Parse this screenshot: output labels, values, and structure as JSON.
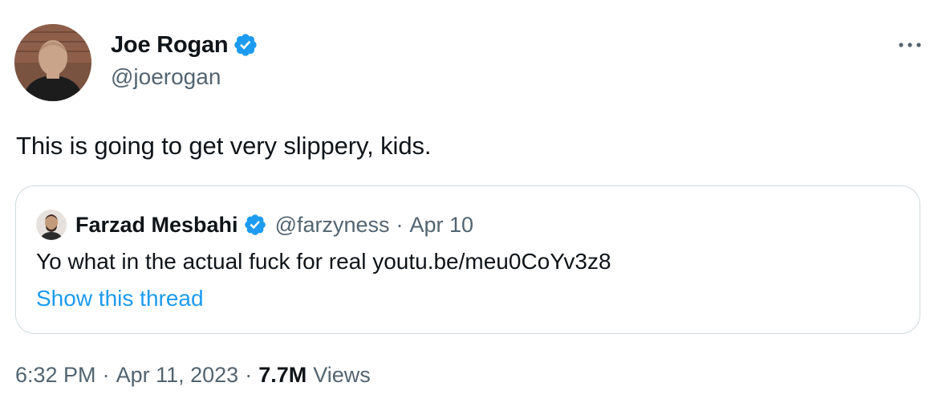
{
  "tweet": {
    "author": {
      "display_name": "Joe Rogan",
      "handle": "@joerogan",
      "verified": true
    },
    "text": "This is going to get very slippery, kids.",
    "quote": {
      "author_name": "Farzad Mesbahi",
      "author_handle": "@farzyness",
      "separator": "·",
      "date": "Apr 10",
      "verified": true,
      "text": "Yo what in the actual fuck for real youtu.be/meu0CoYv3z8",
      "show_thread_label": "Show this thread"
    },
    "meta": {
      "time": "6:32 PM",
      "separator": "·",
      "date": "Apr 11, 2023",
      "views_count": "7.7M",
      "views_label": "Views"
    }
  },
  "icons": {
    "verified": "verified-badge-icon",
    "more": "more-options-icon"
  },
  "colors": {
    "verified_blue": "#1d9bf0",
    "link_blue": "#1d9bf0",
    "secondary_text": "#536471",
    "primary_text": "#0f1419",
    "border": "#cfd9de"
  }
}
